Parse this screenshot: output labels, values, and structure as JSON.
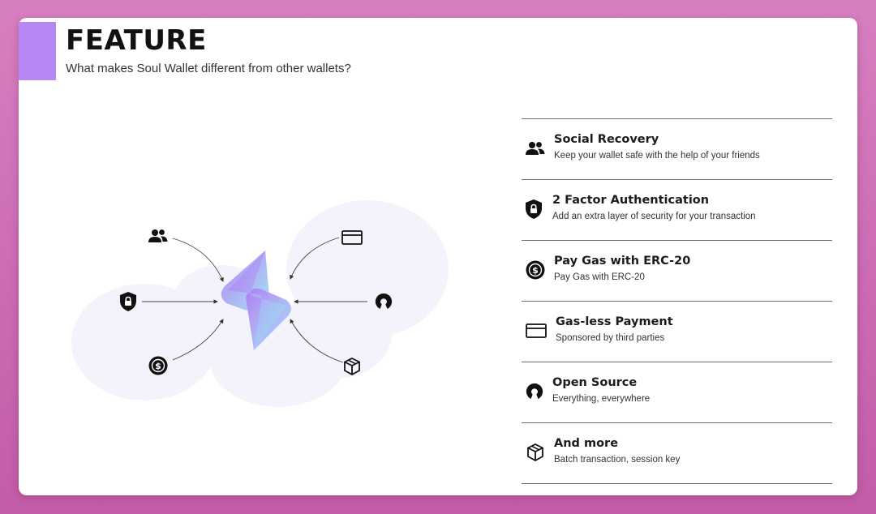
{
  "header": {
    "title": "FEATURE",
    "subtitle": "What makes Soul Wallet different from other wallets?"
  },
  "colors": {
    "background": "#cd6db5",
    "accent": "#b887f6",
    "logo_gradient_start": "#b47cf4",
    "logo_gradient_end": "#9fe3f4"
  },
  "diagram": {
    "center_logo": "soul-wallet-logo",
    "nodes": [
      "users-icon",
      "shield-lock-icon",
      "dollar-coin-icon",
      "card-icon",
      "open-source-icon",
      "box-icon"
    ]
  },
  "features": [
    {
      "icon": "users-icon",
      "title": "Social Recovery",
      "desc": "Keep your wallet safe with the help of your friends"
    },
    {
      "icon": "shield-lock-icon",
      "title": "2 Factor Authentication",
      "desc": "Add an extra layer of security for your transaction"
    },
    {
      "icon": "dollar-coin-icon",
      "title": "Pay Gas with ERC-20",
      "desc": "Pay Gas with ERC-20"
    },
    {
      "icon": "card-icon",
      "title": "Gas-less Payment",
      "desc": "Sponsored by third parties"
    },
    {
      "icon": "open-source-icon",
      "title": "Open Source",
      "desc": "Everything, everywhere"
    },
    {
      "icon": "box-icon",
      "title": "And more",
      "desc": "Batch transaction, session key"
    }
  ]
}
